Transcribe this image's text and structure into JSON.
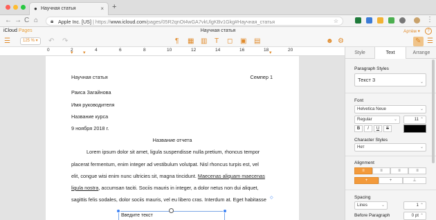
{
  "browser": {
    "tab_title": "Научная статья",
    "tab_close": "×",
    "new_tab": "+",
    "url_origin": "Apple Inc. [US]",
    "url_sep": "|",
    "url_scheme": "https://",
    "url_host": "www.icloud.com",
    "url_path": "/pages/05R2qnOt4wGA7vkUlgKBv1Gkg#Научная_статья",
    "back_icon": "←",
    "forward_icon": "→",
    "reload_icon": "C",
    "home_icon": "⌂",
    "lock_icon": "🔒",
    "star_icon": "☆"
  },
  "app": {
    "brand_icloud": "iCloud",
    "brand_pages": "Pages",
    "doc_title": "Научная статья",
    "user": "Артём ▾",
    "help": "?",
    "zoom": "125 % ▾"
  },
  "toolbar": {
    "paragraph_icon": "¶",
    "table_icon": "▦",
    "chart_icon": "▥",
    "text_icon": "T",
    "shape_icon": "◻",
    "media_icon": "▣",
    "comment_icon": "▤",
    "undo_icon": "↶",
    "redo_icon": "↷",
    "collab_icon": "☻",
    "settings_icon": "⚙",
    "format_icon": "✎",
    "doc_icon": "☰"
  },
  "ruler": {
    "numbers": [
      "0",
      "2",
      "4",
      "6",
      "8",
      "10",
      "12",
      "14",
      "16",
      "18",
      "20"
    ]
  },
  "document": {
    "header_left": "Научная статья",
    "header_right": "Семпер 1",
    "author": "Раиса Загайнова",
    "advisor": "Имя руководителя",
    "course": "Название курса",
    "date": "9 ноября 2018 г.",
    "report_title": "Название отчета",
    "p1": "Lorem ipsum dolor sit amet, ligula suspendisse nulla pretium, rhoncus tempor",
    "p2": "placerat fermentum, enim integer ad vestibulum volutpat. Nisl rhoncus turpis est, vel",
    "p3a": "elit, congue wisi enim nunc ultricies sit, magna tincidunt. ",
    "p3b": "Maecenas aliquam maecenas",
    "p4a": "ligula nostra",
    "p4b": ", accumsan taciti. Sociis mauris in integer, a dolor netus non dui aliquet,",
    "p5": "sagittis felis sodales, dolor sociis mauris, vel eu libero cras. Interdum at. Eget habitasse",
    "textbox": "Введите текст"
  },
  "panel": {
    "tab_style": "Style",
    "tab_text": "Text",
    "tab_arrange": "Arrange",
    "para_styles_label": "Paragraph Styles",
    "para_style": "Текст 3",
    "font_label": "Font",
    "font_name": "Helvetica Neue",
    "font_weight": "Regular",
    "font_size": "11",
    "bold": "B",
    "italic": "I",
    "underline": "U",
    "strike": "S",
    "text_color": "#000000",
    "char_styles_label": "Character Styles",
    "char_style": "Нет",
    "alignment_label": "Alignment",
    "valign_top": "+",
    "valign_mid": "+",
    "valign_bot": "⊥",
    "spacing_label": "Spacing",
    "spacing_mode": "Lines",
    "spacing_value": "1",
    "before_para_label": "Before Paragraph",
    "before_para_value": "0 pt",
    "accent": "#f39a3b"
  }
}
